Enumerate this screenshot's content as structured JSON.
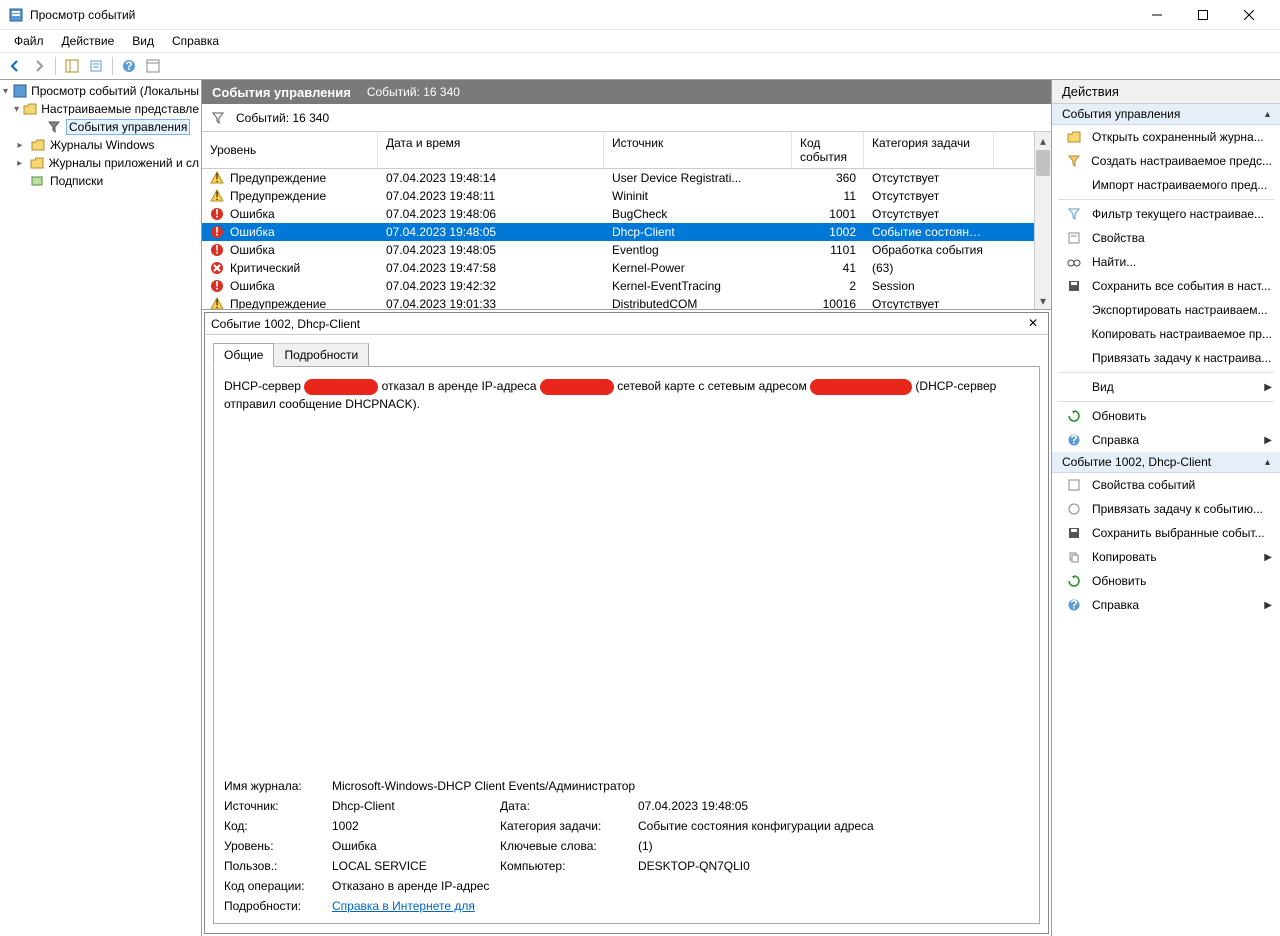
{
  "window": {
    "title": "Просмотр событий"
  },
  "menu": {
    "file": "Файл",
    "action": "Действие",
    "view": "Вид",
    "help": "Справка"
  },
  "tree": {
    "root": "Просмотр событий (Локальны",
    "custom_views": "Настраиваемые представле",
    "admin_events": "События управления",
    "logs": "Журналы Windows",
    "apps": "Журналы приложений и сл",
    "subs": "Подписки"
  },
  "center": {
    "header_title": "События управления",
    "header_count": "Событий: 16 340",
    "filter_count": "Событий: 16 340",
    "columns": {
      "level": "Уровень",
      "date": "Дата и время",
      "source": "Источник",
      "id": "Код события",
      "cat": "Категория задачи"
    },
    "rows": [
      {
        "level": "Предупреждение",
        "lvl": "warn",
        "date": "07.04.2023 19:48:14",
        "source": "User Device Registrati...",
        "id": "360",
        "cat": "Отсутствует"
      },
      {
        "level": "Предупреждение",
        "lvl": "warn",
        "date": "07.04.2023 19:48:11",
        "source": "Wininit",
        "id": "11",
        "cat": "Отсутствует"
      },
      {
        "level": "Ошибка",
        "lvl": "err",
        "date": "07.04.2023 19:48:06",
        "source": "BugCheck",
        "id": "1001",
        "cat": "Отсутствует"
      },
      {
        "level": "Ошибка",
        "lvl": "err",
        "date": "07.04.2023 19:48:05",
        "source": "Dhcp-Client",
        "id": "1002",
        "cat": "Событие состояния ...",
        "selected": true
      },
      {
        "level": "Ошибка",
        "lvl": "err",
        "date": "07.04.2023 19:48:05",
        "source": "Eventlog",
        "id": "1101",
        "cat": "Обработка события"
      },
      {
        "level": "Критический",
        "lvl": "crit",
        "date": "07.04.2023 19:47:58",
        "source": "Kernel-Power",
        "id": "41",
        "cat": "(63)"
      },
      {
        "level": "Ошибка",
        "lvl": "err",
        "date": "07.04.2023 19:42:32",
        "source": "Kernel-EventTracing",
        "id": "2",
        "cat": "Session"
      },
      {
        "level": "Предупреждение",
        "lvl": "warn",
        "date": "07.04.2023 19:01:33",
        "source": "DistributedCOM",
        "id": "10016",
        "cat": "Отсутствует"
      }
    ]
  },
  "detail": {
    "title": "Событие 1002, Dhcp-Client",
    "tabs": {
      "general": "Общие",
      "details": "Подробности"
    },
    "desc_p1": "DHCP-сервер",
    "desc_p2": "отказал в аренде IP-адреса",
    "desc_p3": "сетевой карте с сетевым адресом",
    "desc_p4": "(DHCP-сервер отправил сообщение DHCPNACK).",
    "labels": {
      "log": "Имя журнала:",
      "source": "Источник:",
      "code": "Код:",
      "level": "Уровень:",
      "user": "Пользов.:",
      "opcode": "Код операции:",
      "details": "Подробности:",
      "date": "Дата:",
      "cat": "Категория задачи:",
      "keywords": "Ключевые слова:",
      "computer": "Компьютер:"
    },
    "values": {
      "log": "Microsoft-Windows-DHCP Client Events/Администратор",
      "source": "Dhcp-Client",
      "code": "1002",
      "level": "Ошибка",
      "user": "LOCAL SERVICE",
      "opcode": "Отказано в аренде IP-адрес",
      "details": "Справка в Интернете для ",
      "date": "07.04.2023 19:48:05",
      "cat": "Событие состояния конфигурации адреса",
      "keywords": "(1)",
      "computer": "DESKTOP-QN7QLI0"
    }
  },
  "actions": {
    "header": "Действия",
    "section1": "События управления",
    "items1": [
      "Открыть сохраненный журна...",
      "Создать настраиваемое предс...",
      "Импорт настраиваемого пред..."
    ],
    "items2": [
      "Фильтр текущего настраивае...",
      "Свойства",
      "Найти..."
    ],
    "items3": [
      "Сохранить все события в наст...",
      "Экспортировать настраиваем...",
      "Копировать настраиваемое пр...",
      "Привязать задачу к настраива..."
    ],
    "view": "Вид",
    "refresh": "Обновить",
    "help": "Справка",
    "section2": "Событие 1002, Dhcp-Client",
    "items4": [
      "Свойства событий",
      "Привязать задачу к событию...",
      "Сохранить выбранные событ...",
      "Копировать",
      "Обновить",
      "Справка"
    ]
  }
}
